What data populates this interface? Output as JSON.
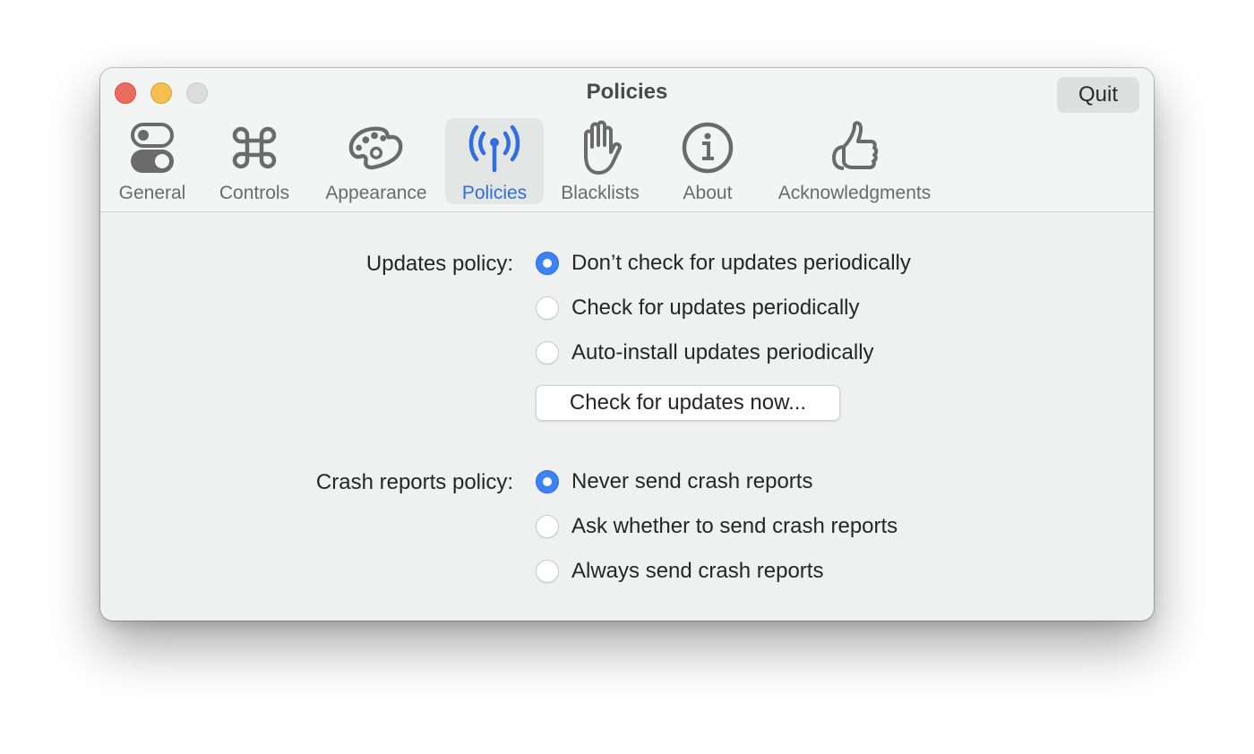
{
  "window": {
    "title": "Policies",
    "quit_label": "Quit"
  },
  "toolbar": {
    "tabs": [
      {
        "label": "General",
        "icon": "toggle-switches-icon",
        "active": false
      },
      {
        "label": "Controls",
        "icon": "command-key-icon",
        "active": false
      },
      {
        "label": "Appearance",
        "icon": "palette-icon",
        "active": false
      },
      {
        "label": "Policies",
        "icon": "antenna-broadcast-icon",
        "active": true
      },
      {
        "label": "Blacklists",
        "icon": "raised-hand-icon",
        "active": false
      },
      {
        "label": "About",
        "icon": "info-circle-icon",
        "active": false
      },
      {
        "label": "Acknowledgments",
        "icon": "thumbs-up-icon",
        "active": false
      }
    ]
  },
  "colors": {
    "accent": "#2f6fe0",
    "radio_selected": "#3d82f5",
    "close": "#ec6a5e",
    "minimize": "#f4bf4f",
    "zoom_disabled": "#dcdcdc"
  },
  "updates": {
    "label": "Updates policy:",
    "options": [
      {
        "label": "Don’t check for updates periodically",
        "selected": true
      },
      {
        "label": "Check for updates periodically",
        "selected": false
      },
      {
        "label": "Auto-install updates periodically",
        "selected": false
      }
    ],
    "check_now_label": "Check for updates now..."
  },
  "crash_reports": {
    "label": "Crash reports policy:",
    "options": [
      {
        "label": "Never send crash reports",
        "selected": true
      },
      {
        "label": "Ask whether to send crash reports",
        "selected": false
      },
      {
        "label": "Always send crash reports",
        "selected": false
      }
    ]
  }
}
